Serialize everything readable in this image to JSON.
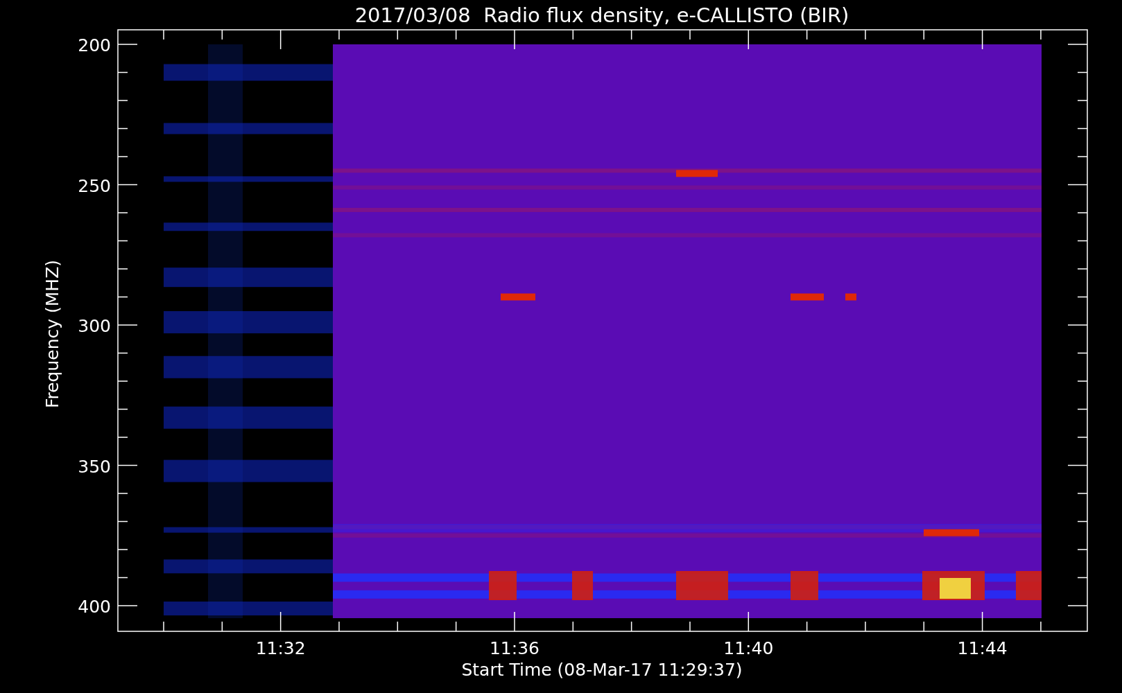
{
  "title": "2017/03/08  Radio flux density, e-CALLISTO (BIR)",
  "y_axis": {
    "label": "Frequency (MHZ)",
    "ticks": [
      "200",
      "250",
      "300",
      "350",
      "400"
    ]
  },
  "x_axis": {
    "label": "Start Time (08-Mar-17 11:29:37)",
    "ticks": [
      "11:32",
      "11:36",
      "11:40",
      "11:44"
    ]
  }
}
